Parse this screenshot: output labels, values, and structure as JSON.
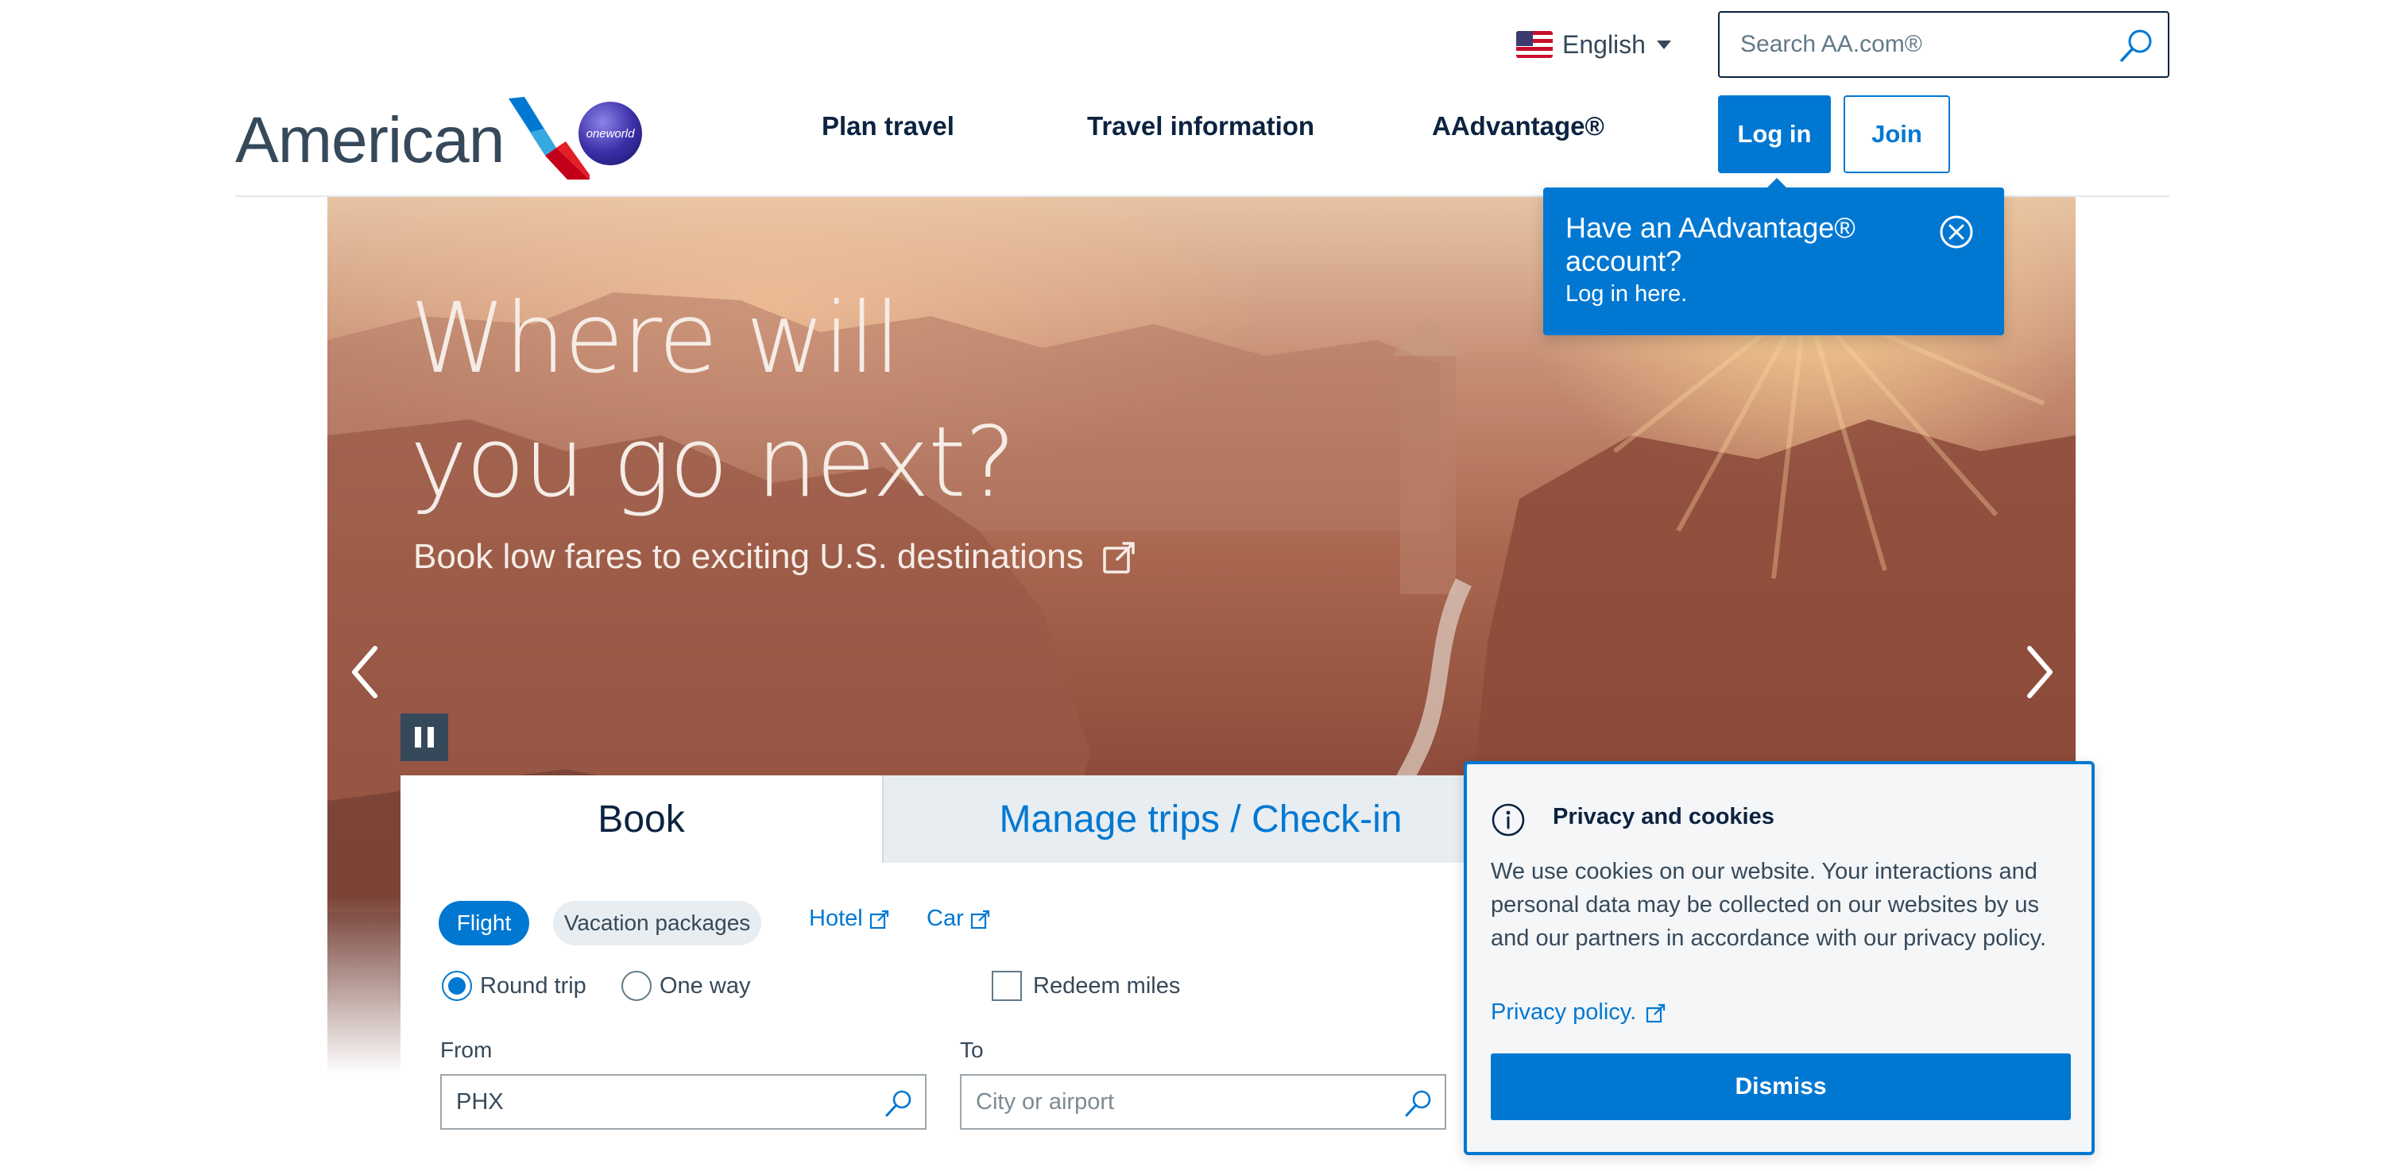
{
  "language": {
    "label": "English",
    "flag_icon": "us-flag-icon"
  },
  "search": {
    "placeholder": "Search AA.com®"
  },
  "brand": {
    "name": "American",
    "partner_logo_text": "oneworld"
  },
  "nav": {
    "items": [
      {
        "label": "Plan travel"
      },
      {
        "label": "Travel information"
      },
      {
        "label": "AAdvantage®"
      }
    ],
    "login_label": "Log in",
    "join_label": "Join"
  },
  "login_tooltip": {
    "title": "Have an AAdvantage® account?",
    "subtitle": "Log in here."
  },
  "hero": {
    "headline_line1": "Where will",
    "headline_line2": "you go next?",
    "subtitle": "Book low fares to exciting U.S. destinations"
  },
  "booking": {
    "tabs": [
      {
        "label": "Book",
        "active": true
      },
      {
        "label": "Manage trips / Check-in",
        "active": false
      }
    ],
    "types": [
      {
        "label": "Flight",
        "selected": true
      },
      {
        "label": "Vacation packages",
        "selected": false
      }
    ],
    "external_links": [
      {
        "label": "Hotel"
      },
      {
        "label": "Car"
      }
    ],
    "trip_options": [
      {
        "label": "Round trip",
        "selected": true
      },
      {
        "label": "One way",
        "selected": false
      }
    ],
    "redeem_miles": {
      "label": "Redeem miles",
      "checked": false
    },
    "from": {
      "label": "From",
      "value": "PHX"
    },
    "to": {
      "label": "To",
      "placeholder": "City or airport"
    }
  },
  "privacy": {
    "title": "Privacy and cookies",
    "body": "We use cookies on our website. Your interactions and personal data may be collected on our websites by us and our partners in accordance with our privacy policy.",
    "link_label": "Privacy policy.",
    "dismiss_label": "Dismiss"
  },
  "colors": {
    "brand_blue": "#0078d2",
    "navy": "#0c2340",
    "text_gray": "#36495a",
    "tab_inactive_bg": "#e7edf1"
  }
}
